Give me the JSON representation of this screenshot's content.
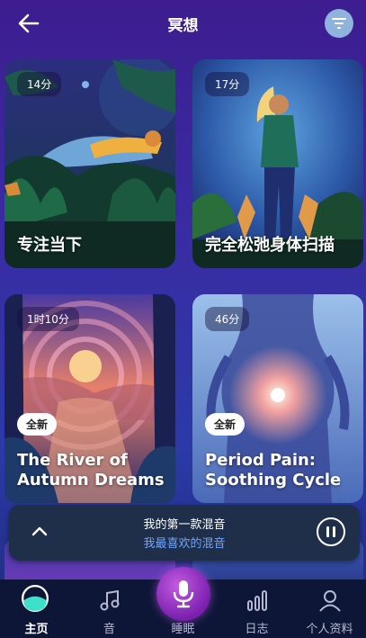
{
  "header": {
    "title": "冥想",
    "back_icon": "arrow-left-icon",
    "filter_icon": "filter-icon"
  },
  "cards": [
    {
      "duration": "14分",
      "title": "专注当下",
      "new_badge": ""
    },
    {
      "duration": "17分",
      "title": "完全松弛身体扫描",
      "new_badge": ""
    },
    {
      "duration": "1时10分",
      "title": "The River of Autumn Dreams",
      "new_badge": "全新"
    },
    {
      "duration": "46分",
      "title": "Period Pain: Soothing Cycle",
      "new_badge": "全新"
    }
  ],
  "player": {
    "title": "我的第一款混音",
    "subtitle": "我最喜欢的混音"
  },
  "nav": {
    "home": "主页",
    "sound": "音",
    "sleep": "睡眠",
    "journal": "日志",
    "profile": "个人资料"
  },
  "colors": {
    "accent": "#6fa4ff",
    "mic": "#a43bd6",
    "nav_bg": "#0e1638"
  }
}
